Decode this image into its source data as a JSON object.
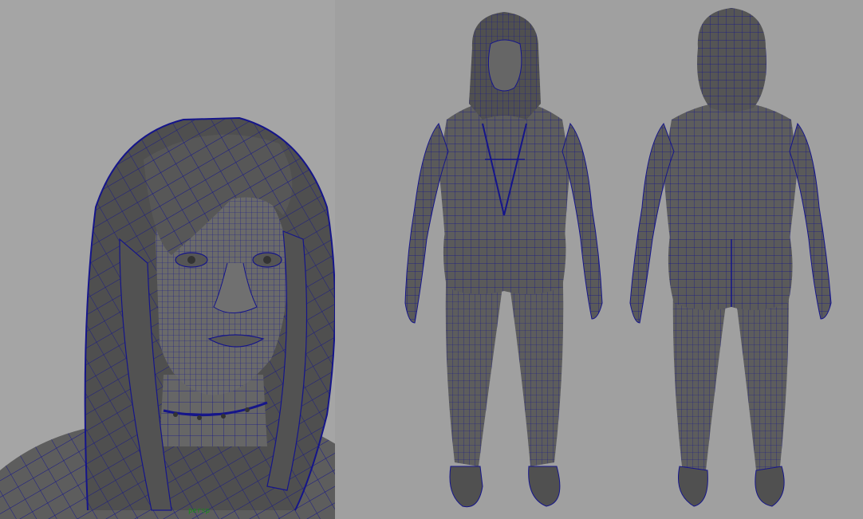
{
  "viewports": {
    "left": {
      "camera_label": "persp"
    },
    "right": {
      "camera_label": ""
    }
  },
  "colors": {
    "mesh_fill": "#5d5d5d",
    "mesh_shade": "#4a4a4a",
    "wire": "#15158a",
    "left_background": "#a5a5a5",
    "right_background": "#a0a0a0",
    "camera_label": "#1a8a1a"
  },
  "models": {
    "closeup": "hooded-head-wireframe",
    "front": "full-body-front-wireframe",
    "back": "full-body-back-wireframe"
  }
}
